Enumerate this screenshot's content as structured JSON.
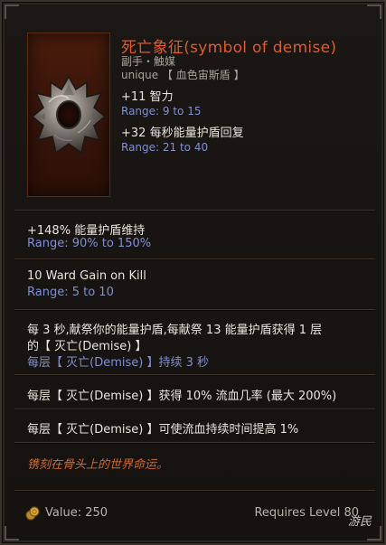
{
  "item": {
    "title": "死亡象征(symbol of demise)",
    "subtitle": "副手・触媒",
    "rarity": "unique 【 血色宙斯盾 】",
    "icon": "spiked-shield-catalyst-icon"
  },
  "implicits": [
    {
      "text": "+11 智力",
      "range": "Range: 9 to 15"
    },
    {
      "text": "+32 每秒能量护盾回复",
      "range": "Range: 21 to 40"
    }
  ],
  "mods": [
    {
      "line1": "+148% 能量护盾维持",
      "line2": "Range: 90% to 150%"
    },
    {
      "line1": "10 Ward Gain on Kill",
      "line2": "Range: 5 to 10"
    },
    {
      "line1": "每 3 秒,献祭你的能量护盾,每献祭 13 能量护盾获得 1 层",
      "line2": "的【 灭亡(Demise) 】",
      "line3": "每层【 灭亡(Demise) 】持续 3 秒"
    },
    {
      "line1": "每层【 灭亡(Demise) 】获得 10% 流血几率 (最大 200%)"
    },
    {
      "line1": "每层【 灭亡(Demise) 】可使流血持续时间提高 1%"
    }
  ],
  "lore": "镌刻在骨头上的世界命运。",
  "footer": {
    "value": "Value: 250",
    "requires": "Requires Level 80",
    "coin_icon": "gold-coin-icon"
  },
  "watermark": "游民"
}
